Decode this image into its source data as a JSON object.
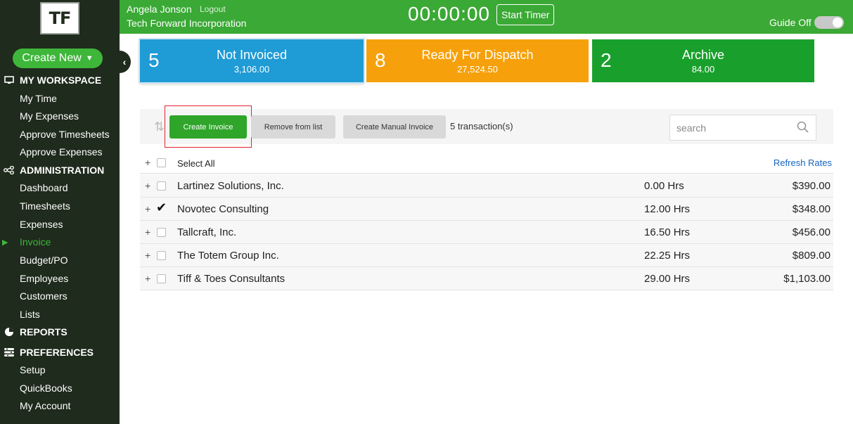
{
  "sidebar": {
    "logo": "TF",
    "create_new": "Create New",
    "sections": [
      {
        "title": "MY WORKSPACE",
        "icon": "monitor-icon",
        "items": [
          "My Time",
          "My Expenses",
          "Approve Timesheets",
          "Approve Expenses"
        ]
      },
      {
        "title": "ADMINISTRATION",
        "icon": "share-icon",
        "items": [
          "Dashboard",
          "Timesheets",
          "Expenses",
          "Invoice",
          "Budget/PO",
          "Employees",
          "Customers",
          "Lists"
        ]
      },
      {
        "title": "REPORTS",
        "icon": "pie-chart-icon",
        "items": []
      },
      {
        "title": "PREFERENCES",
        "icon": "sliders-icon",
        "items": [
          "Setup",
          "QuickBooks",
          "My Account"
        ]
      }
    ],
    "active_item": "Invoice"
  },
  "topbar": {
    "user_name": "Angela Jonson",
    "logout": "Logout",
    "company": "Tech Forward Incorporation",
    "timer": "00:00:00",
    "start_timer": "Start Timer",
    "guide_label": "Guide Off"
  },
  "cards": {
    "not_invoiced": {
      "count": "5",
      "title": "Not Invoiced",
      "amount": "3,106.00"
    },
    "ready": {
      "count": "8",
      "title": "Ready For Dispatch",
      "amount": "27,524.50"
    },
    "archive": {
      "count": "2",
      "title": "Archive",
      "amount": "84.00"
    }
  },
  "toolbar": {
    "create_invoice": "Create Invoice",
    "remove_from_list": "Remove from list",
    "create_manual_invoice": "Create Manual Invoice",
    "transactions": "5 transaction(s)",
    "search_placeholder": "search"
  },
  "list": {
    "select_all": "Select All",
    "refresh_rates": "Refresh Rates",
    "rows": [
      {
        "name": "Lartinez Solutions, Inc.",
        "hours": "0.00 Hrs",
        "amount": "$390.00",
        "checked": false
      },
      {
        "name": "Novotec Consulting",
        "hours": "12.00 Hrs",
        "amount": "$348.00",
        "checked": true
      },
      {
        "name": "Tallcraft, Inc.",
        "hours": "16.50 Hrs",
        "amount": "$456.00",
        "checked": false
      },
      {
        "name": "The Totem Group Inc.",
        "hours": "22.25 Hrs",
        "amount": "$809.00",
        "checked": false
      },
      {
        "name": "Tiff & Toes Consultants",
        "hours": "29.00 Hrs",
        "amount": "$1,103.00",
        "checked": false
      }
    ]
  },
  "colors": {
    "sidebar_bg": "#1f2b1c",
    "brand_green": "#3aa935",
    "card_blue": "#1f9bd5",
    "card_orange": "#f6a10b",
    "card_green": "#19a02c",
    "highlight_red": "#e0212b"
  }
}
